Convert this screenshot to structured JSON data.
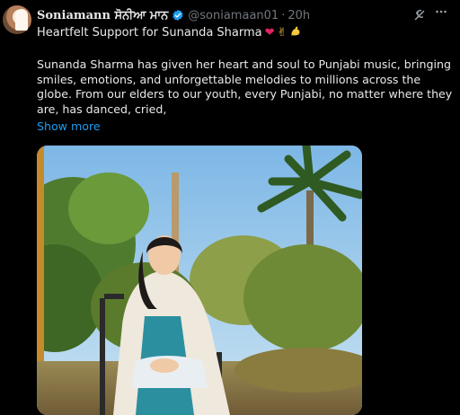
{
  "author": {
    "display_name": "Soniamann",
    "display_name_punjabi": "ਸੋਨੀਆ ਮਾਨ",
    "handle": "@soniamaan01",
    "separator": "·",
    "time": "20h",
    "verified": true
  },
  "tweet": {
    "headline": "Heartfelt Support for Sunanda Sharma",
    "headline_emojis": [
      "heart-emoji",
      "victory-hand-emoji",
      "flexed-biceps-emoji"
    ],
    "body": "Sunanda Sharma has given her heart and soul to Punjabi music, bringing smiles, emotions, and unforgettable melodies to millions across the globe. From our elders to our youth, every Punjabi, no matter where they are, has danced, cried,",
    "show_more_label": "Show more"
  },
  "icons": {
    "grok": "grok-icon",
    "more": "more-options-icon",
    "verified": "verified-badge-icon"
  },
  "colors": {
    "background": "#000000",
    "text": "#e7e9ea",
    "muted": "#71767b",
    "link": "#1d9bf0",
    "verified": "#1d9bf0",
    "heart": "#e0245e"
  }
}
